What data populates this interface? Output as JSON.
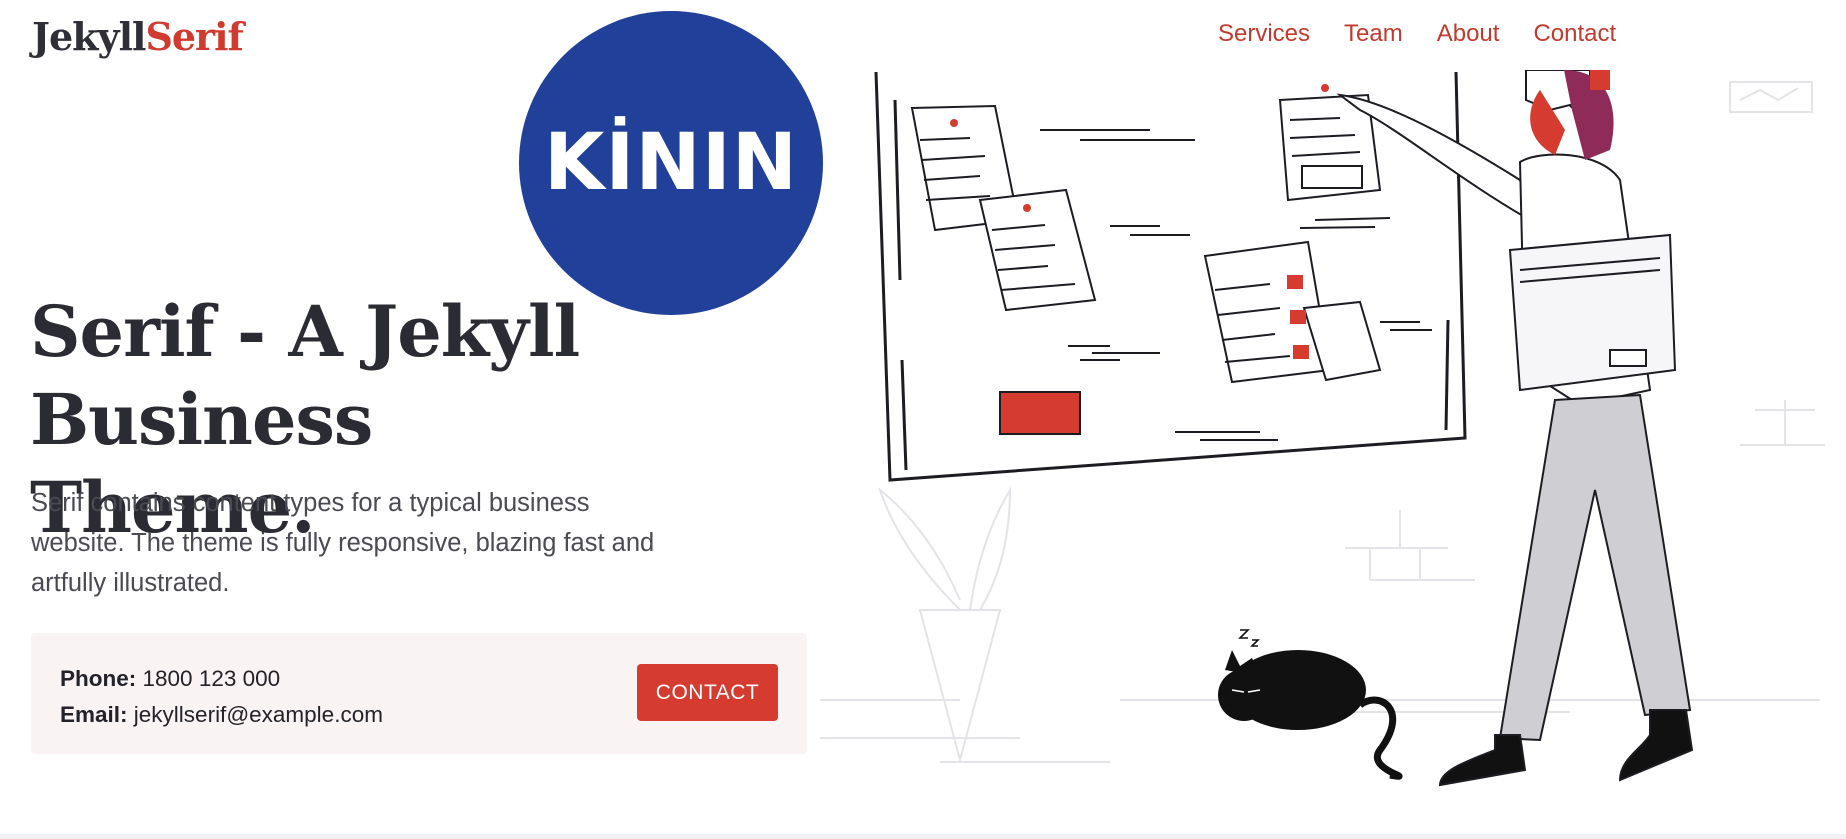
{
  "brand": {
    "part1": "Jekyll",
    "part2": "Serif"
  },
  "nav": {
    "items": [
      "Services",
      "Team",
      "About",
      "Contact"
    ]
  },
  "overlay_badge": {
    "text": "KİNIN",
    "color": "#21409a"
  },
  "hero": {
    "title_line1": "Serif - A Jekyll",
    "title_line2": "Business Theme.",
    "description": "Serif contains content types for a typical business website. The theme is fully responsive, blazing fast and artfully illustrated."
  },
  "contact": {
    "phone_label": "Phone:",
    "phone_value": "1800 123 000",
    "email_label": "Email:",
    "email_value": "jekyllserif@example.com",
    "button_label": "CONTACT"
  },
  "colors": {
    "accent": "#d53b2f",
    "text": "#2b2b33",
    "badge": "#21409a"
  }
}
